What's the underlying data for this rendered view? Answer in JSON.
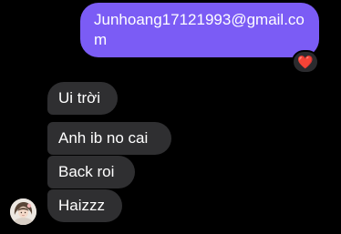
{
  "conversation": {
    "outgoing": {
      "text": "Junhoang17121993@gmail.com",
      "reaction": "❤️"
    },
    "incoming": [
      {
        "text": "Ui trời"
      },
      {
        "text": "Anh ib no cai"
      },
      {
        "text": "Back roi"
      },
      {
        "text": "Haizzz"
      }
    ]
  },
  "colors": {
    "background": "#000000",
    "outgoing_bubble": "#7b5cf5",
    "incoming_bubble": "#2f2f31",
    "text": "#ffffff"
  },
  "icons": {
    "reaction": "red-heart-emoji",
    "avatar": "contact-avatar-photo"
  }
}
